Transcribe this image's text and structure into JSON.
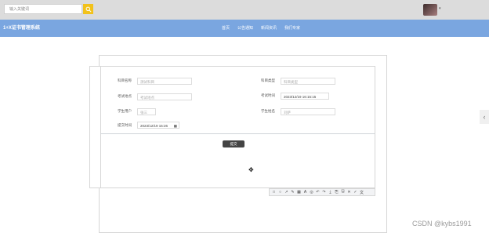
{
  "topbar": {
    "search_placeholder": "输入关键词"
  },
  "nav": {
    "brand": "1+X证书管理系统",
    "items": [
      "首页",
      "公告通知",
      "新闻资讯",
      "我们专家"
    ]
  },
  "form": {
    "fields": [
      {
        "label": "科目名称",
        "value": "测试科目"
      },
      {
        "label": "科目类型",
        "value": "科目类型"
      },
      {
        "label": "考试地点",
        "value": "考试地点"
      },
      {
        "label": "考试时间",
        "value": "2023/12/19 16:15:15"
      },
      {
        "label": "学生用户",
        "value": "张三"
      },
      {
        "label": "学生姓名",
        "value": "刘萨"
      },
      {
        "label": "提交时间",
        "value": "2023/12/19 15:26"
      }
    ],
    "submit_label": "提交"
  },
  "toolbar": {
    "icons": [
      "rect-icon",
      "circle-icon",
      "arrow-icon",
      "pen-icon",
      "mosaic-icon",
      "text-icon",
      "undo-icon",
      "redo-icon",
      "download-icon",
      "copy-icon",
      "save-icon",
      "close-icon",
      "check-icon",
      "ocr-icon"
    ],
    "glyphs": [
      "□",
      "○",
      "↗",
      "✎",
      "▦",
      "A",
      "◎",
      "↶",
      "↷",
      "⤓",
      "⎘",
      "🖫",
      "✕",
      "✓",
      "文"
    ]
  },
  "watermark": "CSDN @kybs1991"
}
